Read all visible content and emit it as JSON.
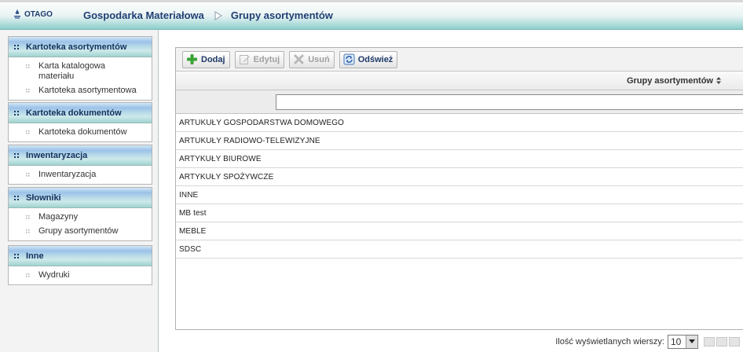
{
  "app": {
    "logo_text": "OTAGO",
    "breadcrumb": [
      "Gospodarka Materiałowa",
      "Grupy asortymentów"
    ]
  },
  "sidebar": {
    "panels": [
      {
        "title": "Kartoteka asortymentów",
        "items": [
          "Karta katalogowa materiału",
          "Kartoteka asortymentowa"
        ]
      },
      {
        "title": "Kartoteka dokumentów",
        "items": [
          "Kartoteka dokumentów"
        ]
      },
      {
        "title": "Inwentaryzacja",
        "items": [
          "Inwentaryzacja"
        ]
      },
      {
        "title": "Słowniki",
        "items": [
          "Magazyny",
          "Grupy asortymentów"
        ]
      },
      {
        "title": "Inne",
        "items": [
          "Wydruki"
        ]
      }
    ]
  },
  "toolbar": {
    "add_label": "Dodaj",
    "edit_label": "Edytuj",
    "delete_label": "Usuń",
    "refresh_label": "Odśwież"
  },
  "grid": {
    "column_header": "Grupy asortymentów",
    "filter_value": "",
    "rows": [
      "ARTUKUŁY GOSPODARSTWA DOMOWEGO",
      "ARTUKUŁY RADIOWO-TELEWIZYJNE",
      "ARTYKUŁY BIUROWE",
      "ARTYKUŁY SPOŻYWCZE",
      "INNE",
      "MB test",
      "MEBLE",
      "SDSC"
    ]
  },
  "pager": {
    "rows_label": "Ilość wyświetlanych wierszy:",
    "rows_value": "10"
  },
  "colors": {
    "header_teal": "#8ccfcc",
    "title_blue": "#1f3f74",
    "panel_head_blue": "#9bc2e9"
  }
}
